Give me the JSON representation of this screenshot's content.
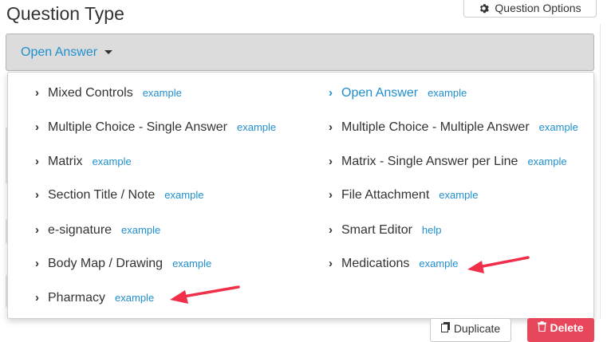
{
  "header": {
    "title": "Question Type"
  },
  "toolbar": {
    "question_options_label": "Question Options"
  },
  "select": {
    "value": "Open Answer"
  },
  "options": [
    {
      "label": "Mixed Controls",
      "link": "example"
    },
    {
      "label": "Open Answer",
      "link": "example",
      "selected": true
    },
    {
      "label": "Multiple Choice - Single Answer",
      "link": "example"
    },
    {
      "label": "Multiple Choice - Multiple Answer",
      "link": "example"
    },
    {
      "label": "Matrix",
      "link": "example"
    },
    {
      "label": "Matrix - Single Answer per Line",
      "link": "example"
    },
    {
      "label": "Section Title / Note",
      "link": "example"
    },
    {
      "label": "File Attachment",
      "link": "example"
    },
    {
      "label": "e-signature",
      "link": "example"
    },
    {
      "label": "Smart Editor",
      "link": "help"
    },
    {
      "label": "Body Map / Drawing",
      "link": "example"
    },
    {
      "label": "Medications",
      "link": "example"
    },
    {
      "label": "Pharmacy",
      "link": "example"
    }
  ],
  "actions": {
    "duplicate_label": "Duplicate",
    "delete_label": "Delete"
  },
  "colors": {
    "link": "#1f8fce",
    "annotation_arrow": "#f0304a",
    "delete": "#e8465a"
  }
}
